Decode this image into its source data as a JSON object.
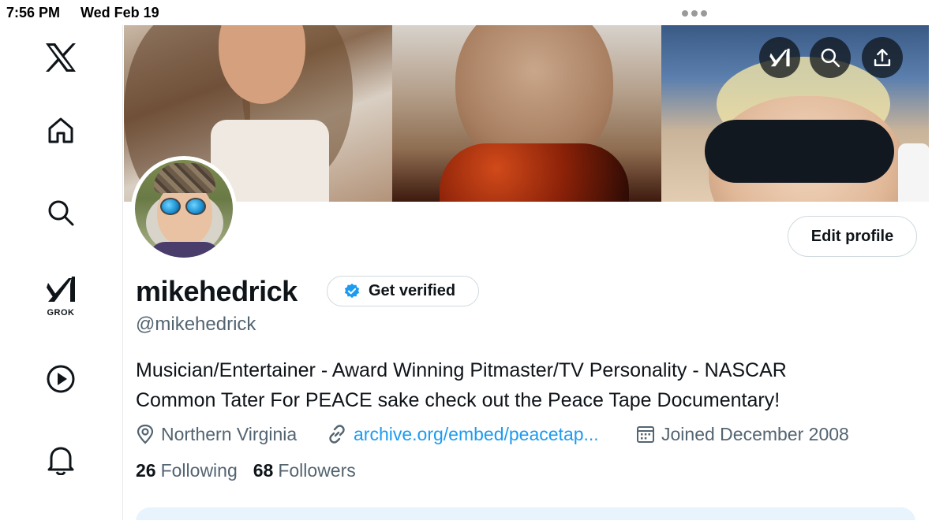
{
  "status_bar": {
    "time": "7:56 PM",
    "date": "Wed Feb 19"
  },
  "sidebar": {
    "items": [
      {
        "name": "x-logo",
        "icon": "x-logo-icon"
      },
      {
        "name": "home",
        "icon": "home-icon"
      },
      {
        "name": "search",
        "icon": "search-icon"
      },
      {
        "name": "grok",
        "icon": "grok-icon",
        "label": "GROK"
      },
      {
        "name": "video",
        "icon": "play-icon"
      },
      {
        "name": "notifications",
        "icon": "bell-icon"
      }
    ]
  },
  "banner_actions": [
    {
      "name": "grok",
      "icon": "grok-icon"
    },
    {
      "name": "search",
      "icon": "search-icon"
    },
    {
      "name": "share",
      "icon": "share-icon"
    }
  ],
  "profile": {
    "display_name": "mikehedrick",
    "handle": "@mikehedrick",
    "get_verified_label": "Get verified",
    "edit_profile_label": "Edit profile",
    "bio_line1": "Musician/Entertainer - Award Winning Pitmaster/TV Personality - NASCAR",
    "bio_line2": "Common Tater For PEACE sake check out the Peace Tape Documentary!",
    "location": "Northern Virginia",
    "website": "archive.org/embed/peacetap...",
    "joined": "Joined December 2008",
    "following_count": "26",
    "following_label": "Following",
    "followers_count": "68",
    "followers_label": "Followers"
  },
  "colors": {
    "accent": "#1d9bf0",
    "text_primary": "#0f1419",
    "text_secondary": "#536471",
    "border": "#cfd9de"
  }
}
